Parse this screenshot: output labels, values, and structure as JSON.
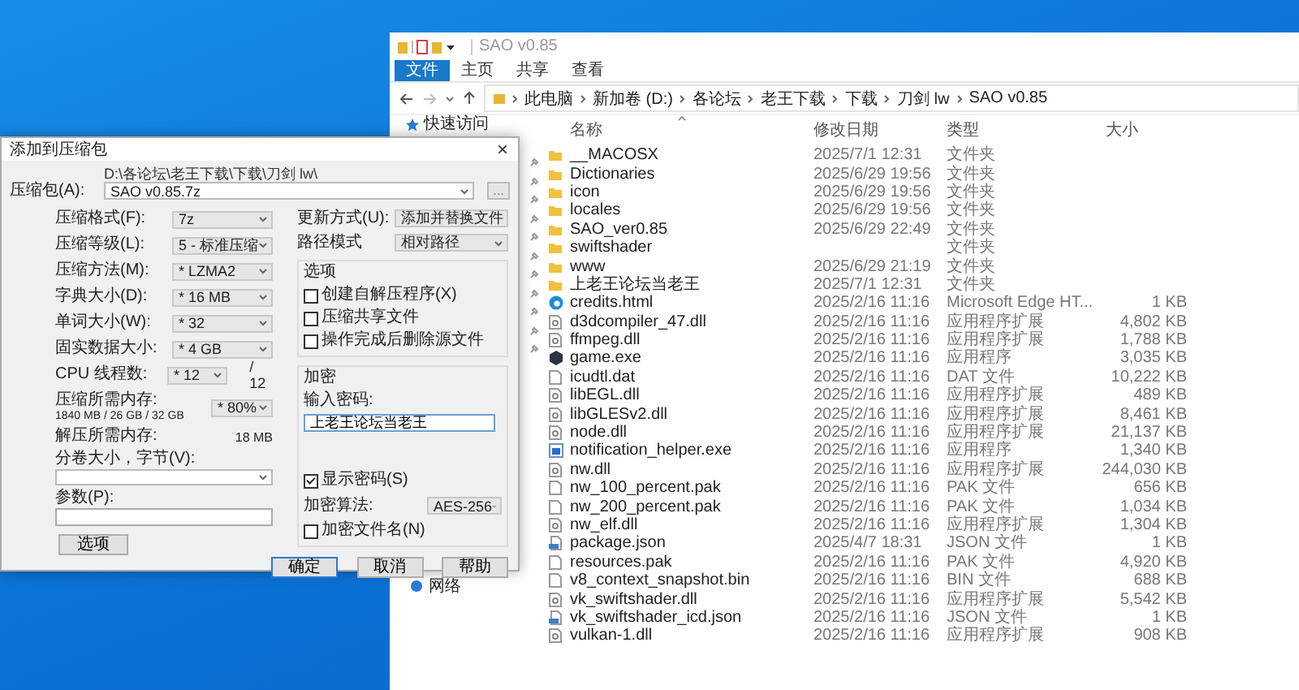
{
  "explorer": {
    "title": "SAO v0.85",
    "ribbon_tabs": [
      {
        "label": "文件",
        "selected": true
      },
      {
        "label": "主页",
        "selected": false
      },
      {
        "label": "共享",
        "selected": false
      },
      {
        "label": "查看",
        "selected": false
      }
    ],
    "breadcrumb": [
      "此电脑",
      "新加卷 (D:)",
      "各论坛",
      "老王下载",
      "下载",
      "刀剑 lw",
      "SAO v0.85"
    ],
    "nav": {
      "top": "快速访问",
      "bottom": "网络"
    },
    "columns": [
      "名称",
      "修改日期",
      "类型",
      "大小"
    ],
    "files": [
      {
        "kind": "folder",
        "name": "__MACOSX",
        "date": "2025/7/1 12:31",
        "type": "文件夹"
      },
      {
        "kind": "folder",
        "name": "Dictionaries",
        "date": "2025/6/29 19:56",
        "type": "文件夹"
      },
      {
        "kind": "folder",
        "name": "icon",
        "date": "2025/6/29 19:56",
        "type": "文件夹"
      },
      {
        "kind": "folder",
        "name": "locales",
        "date": "2025/6/29 19:56",
        "type": "文件夹"
      },
      {
        "kind": "folder",
        "name": "SAO_ver0.85",
        "date": "2025/6/29 22:49",
        "type": "文件夹"
      },
      {
        "kind": "folder",
        "name": "swiftshader",
        "type": "文件夹"
      },
      {
        "kind": "folder",
        "name": "www",
        "date": "2025/6/29 21:19",
        "type": "文件夹"
      },
      {
        "kind": "folder",
        "name": "上老王论坛当老王",
        "date": "2025/7/1 12:31",
        "type": "文件夹"
      },
      {
        "kind": "html",
        "name": "credits.html",
        "date": "2025/2/16 11:16",
        "type": "Microsoft Edge HT...",
        "size": "1 KB"
      },
      {
        "kind": "dll",
        "name": "d3dcompiler_47.dll",
        "date": "2025/2/16 11:16",
        "type": "应用程序扩展",
        "size": "4,802 KB"
      },
      {
        "kind": "dll",
        "name": "ffmpeg.dll",
        "date": "2025/2/16 11:16",
        "type": "应用程序扩展",
        "size": "1,788 KB"
      },
      {
        "kind": "exe",
        "name": "game.exe",
        "date": "2025/2/16 11:16",
        "type": "应用程序",
        "size": "3,035 KB"
      },
      {
        "kind": "file",
        "name": "icudtl.dat",
        "date": "2025/2/16 11:16",
        "type": "DAT 文件",
        "size": "10,222 KB"
      },
      {
        "kind": "dll",
        "name": "libEGL.dll",
        "date": "2025/2/16 11:16",
        "type": "应用程序扩展",
        "size": "489 KB"
      },
      {
        "kind": "dll",
        "name": "libGLESv2.dll",
        "date": "2025/2/16 11:16",
        "type": "应用程序扩展",
        "size": "8,461 KB"
      },
      {
        "kind": "dll",
        "name": "node.dll",
        "date": "2025/2/16 11:16",
        "type": "应用程序扩展",
        "size": "21,137 KB"
      },
      {
        "kind": "app",
        "name": "notification_helper.exe",
        "date": "2025/2/16 11:16",
        "type": "应用程序",
        "size": "1,340 KB"
      },
      {
        "kind": "dll",
        "name": "nw.dll",
        "date": "2025/2/16 11:16",
        "type": "应用程序扩展",
        "size": "244,030 KB"
      },
      {
        "kind": "file",
        "name": "nw_100_percent.pak",
        "date": "2025/2/16 11:16",
        "type": "PAK 文件",
        "size": "656 KB"
      },
      {
        "kind": "file",
        "name": "nw_200_percent.pak",
        "date": "2025/2/16 11:16",
        "type": "PAK 文件",
        "size": "1,034 KB"
      },
      {
        "kind": "dll",
        "name": "nw_elf.dll",
        "date": "2025/2/16 11:16",
        "type": "应用程序扩展",
        "size": "1,304 KB"
      },
      {
        "kind": "json",
        "name": "package.json",
        "date": "2025/4/7 18:31",
        "type": "JSON 文件",
        "size": "1 KB"
      },
      {
        "kind": "file",
        "name": "resources.pak",
        "date": "2025/2/16 11:16",
        "type": "PAK 文件",
        "size": "4,920 KB"
      },
      {
        "kind": "file",
        "name": "v8_context_snapshot.bin",
        "date": "2025/2/16 11:16",
        "type": "BIN 文件",
        "size": "688 KB"
      },
      {
        "kind": "dll",
        "name": "vk_swiftshader.dll",
        "date": "2025/2/16 11:16",
        "type": "应用程序扩展",
        "size": "5,542 KB"
      },
      {
        "kind": "json",
        "name": "vk_swiftshader_icd.json",
        "date": "2025/2/16 11:16",
        "type": "JSON 文件",
        "size": "1 KB"
      },
      {
        "kind": "dll",
        "name": "vulkan-1.dll",
        "date": "2025/2/16 11:16",
        "type": "应用程序扩展",
        "size": "908 KB"
      }
    ]
  },
  "dialog": {
    "title": "添加到压缩包",
    "close": "×",
    "archive": {
      "label": "压缩包(A):",
      "path": "D:\\各论坛\\老王下载\\下载\\刀剑 lw\\",
      "value": "SAO v0.85.7z",
      "browse": "..."
    },
    "fields": [
      {
        "label": "压缩格式(F):",
        "value": "7z"
      },
      {
        "label": "压缩等级(L):",
        "value": "5 - 标准压缩"
      },
      {
        "label": "压缩方法(M):",
        "value": "* LZMA2"
      },
      {
        "label": "字典大小(D):",
        "value": "* 16 MB"
      },
      {
        "label": "单词大小(W):",
        "value": "* 32"
      },
      {
        "label": "固实数据大小:",
        "value": "* 4 GB"
      },
      {
        "label": "CPU 线程数:",
        "value": "* 12",
        "suffix": "/ 12"
      }
    ],
    "memory": {
      "label": "压缩所需内存:",
      "detail": "1840 MB / 26 GB / 32 GB",
      "value": "* 80%"
    },
    "decompress": {
      "label": "解压所需内存:",
      "value": "18 MB"
    },
    "volume": {
      "label": "分卷大小，字节(V):"
    },
    "params": {
      "label": "参数(P):"
    },
    "options_button": "选项",
    "update": {
      "label": "更新方式(U):",
      "value": "添加并替换文件"
    },
    "path_mode": {
      "label": "路径模式",
      "value": "相对路径"
    },
    "options": {
      "title": "选项",
      "items": [
        {
          "label": "创建自解压程序(X)",
          "checked": false
        },
        {
          "label": "压缩共享文件",
          "checked": false
        },
        {
          "label": "操作完成后删除源文件",
          "checked": false
        }
      ]
    },
    "encryption": {
      "title": "加密",
      "password_label": "输入密码:",
      "password": "上老王论坛当老王",
      "show_password": {
        "label": "显示密码(S)",
        "checked": true
      },
      "method_label": "加密算法:",
      "method": "AES-256",
      "encrypt_names": {
        "label": "加密文件名(N)",
        "checked": false
      }
    },
    "buttons": [
      {
        "label": "确定",
        "default": true
      },
      {
        "label": "取消",
        "default": false
      },
      {
        "label": "帮助",
        "default": false
      }
    ]
  }
}
